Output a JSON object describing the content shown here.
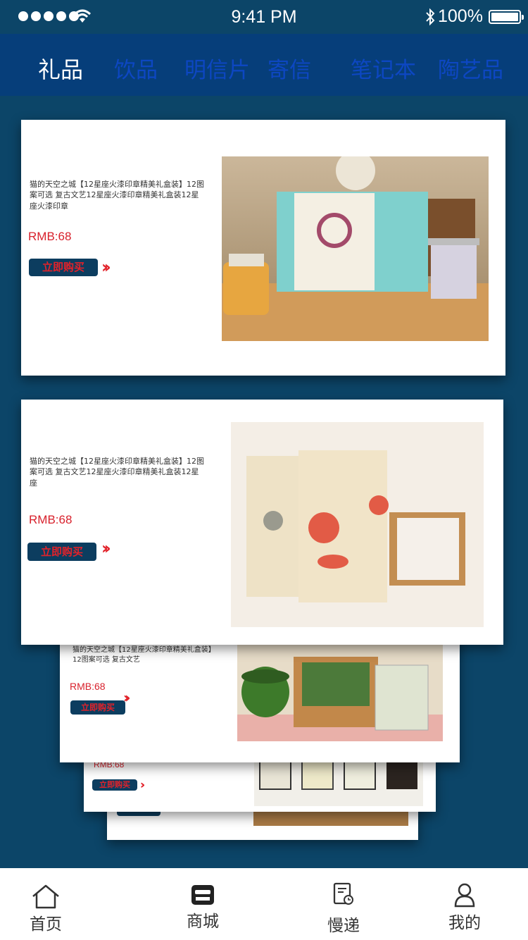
{
  "status_bar": {
    "time": "9:41 PM",
    "battery": "100%"
  },
  "tabs": [
    {
      "label": "礼品",
      "active": true
    },
    {
      "label": "饮品",
      "active": false
    },
    {
      "label": "明信片",
      "active": false
    },
    {
      "label": "寄信",
      "active": false
    },
    {
      "label": "笔记本",
      "active": false
    },
    {
      "label": "陶艺品",
      "active": false
    }
  ],
  "cards": [
    {
      "desc": "猫的天空之城【12星座火漆印章精美礼盒装】12图案可选 复古文艺12星座火漆印章精美礼盒装12星座火漆印章",
      "price": "RMB:68",
      "buy_label": "立即购买"
    },
    {
      "desc": "猫的天空之城【12星座火漆印章精美礼盒装】12图案可选 复古文艺12星座火漆印章精美礼盒装12星座",
      "price": "RMB:68",
      "buy_label": "立即购买"
    },
    {
      "desc": "猫的天空之城【12星座火漆印章精美礼盒装】12图案可选 复古文艺",
      "price": "RMB:68",
      "buy_label": "立即购买"
    },
    {
      "price": "RMB:68",
      "buy_label": "立即购买"
    }
  ],
  "bottom_nav": [
    {
      "label": "首页",
      "icon": "home-icon"
    },
    {
      "label": "商城",
      "icon": "store-icon"
    },
    {
      "label": "慢递",
      "icon": "slow-mail-icon"
    },
    {
      "label": "我的",
      "icon": "profile-icon"
    }
  ],
  "colors": {
    "background": "#0c4568",
    "tab_bar": "#063e7a",
    "tab_inactive": "#0d47c2",
    "price": "#d8212c",
    "buy_button": "#0c3d5f"
  }
}
